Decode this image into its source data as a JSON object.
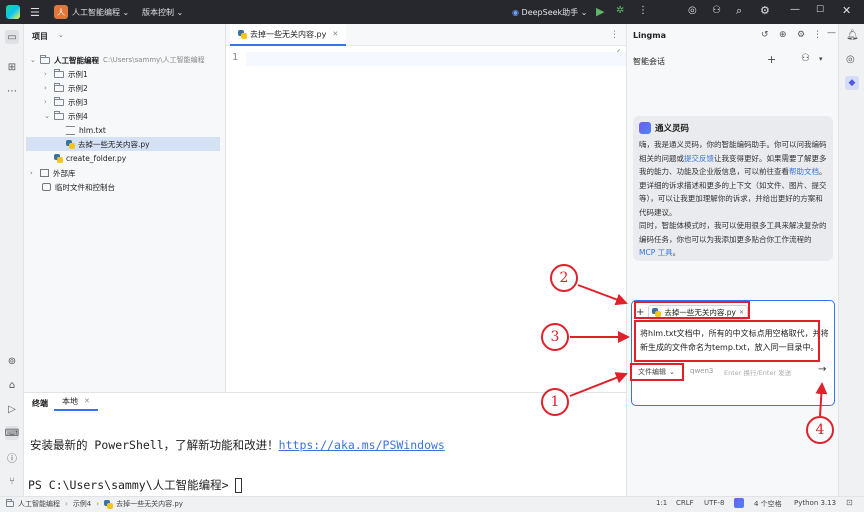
{
  "titlebar": {
    "project_badge": "人",
    "project_name": "人工智能编程",
    "vcs_label": "版本控制",
    "run_config": "DeepSeek助手"
  },
  "project_panel": {
    "title": "项目",
    "root_name": "人工智能编程",
    "root_path": "C:\\Users\\sammy\\人工智能编程",
    "items": [
      {
        "label": "示例1"
      },
      {
        "label": "示例2"
      },
      {
        "label": "示例3"
      },
      {
        "label": "示例4"
      },
      {
        "label": "hlm.txt"
      },
      {
        "label": "去掉一些无关内容.py"
      },
      {
        "label": "create_folder.py"
      },
      {
        "label": "外部库"
      },
      {
        "label": "临时文件和控制台"
      }
    ]
  },
  "editor": {
    "tab_label": "去掉一些无关内容.py",
    "line_number": "1"
  },
  "terminal": {
    "tabs": [
      "终端",
      "本地"
    ],
    "line1_text": "安装最新的 PowerShell，了解新功能和改进！",
    "line1_link": "https://aka.ms/PSWindows",
    "prompt": "PS C:\\Users\\sammy\\人工智能编程> "
  },
  "lingma": {
    "title": "Lingma",
    "tab_label": "智能会话",
    "card": {
      "title": "通义灵码",
      "p1_a": "嗨，我是通义灵码，你的智能编码助手。你可以问我编码相关的问题或",
      "p1_link1": "提交反馈",
      "p1_b": "让我变得更好。如果需要了解更多我的能力、功能及企业版信息，可以前往查看",
      "p1_link2": "帮助文档",
      "p1_c": "。",
      "p2": "更详细的诉求描述和更多的上下文（如文件、图片、提交等），可以让我更加理解你的诉求，并给出更好的方案和代码建议。",
      "p3_a": "同时，智能体模式时，我可以使用很多工具来解决复杂的编码任务，你也可以为我添加更多贴合你工作流程的",
      "p3_link": "MCP 工具",
      "p3_b": "。"
    },
    "input": {
      "context_file": "去掉一些无关内容.py",
      "message": "将hlm.txt文档中，所有的中文标点用空格取代，并将新生成的文件命名为temp.txt，放入同一目录中。",
      "mode": "文件编辑",
      "model": "qwen3",
      "hint": "Enter 换行/Enter 发送"
    }
  },
  "statusbar": {
    "crumbs": [
      "人工智能编程",
      "示例4",
      "去掉一些无关内容.py"
    ],
    "position": "1:1",
    "line_sep": "CRLF",
    "encoding": "UTF-8",
    "indent": "4 个空格",
    "interpreter": "Python 3.13"
  },
  "annotations": [
    "1",
    "2",
    "3",
    "4"
  ],
  "colors": {
    "annotation_red": "#e0202a",
    "link_blue": "#3b74d9",
    "titlebar_bg": "#27282e"
  }
}
